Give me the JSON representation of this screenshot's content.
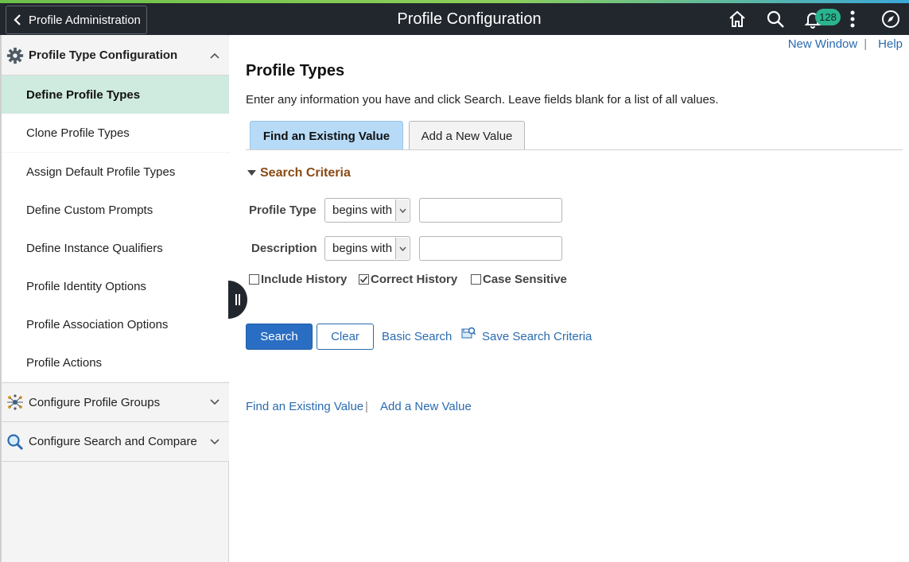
{
  "header": {
    "back_label": "Profile Administration",
    "title": "Profile Configuration",
    "notification_count": "128",
    "icons": [
      "home-icon",
      "search-icon",
      "bell-icon",
      "more-icon",
      "navigator-icon"
    ]
  },
  "sidebar": {
    "group1": {
      "label": "Profile Type Configuration",
      "icon": "gear-icon"
    },
    "items": [
      {
        "label": "Define Profile Types",
        "active": true
      },
      {
        "label": "Clone Profile Types"
      },
      {
        "label": "Assign Default Profile Types"
      },
      {
        "label": "Define Custom Prompts"
      },
      {
        "label": "Define Instance Qualifiers"
      },
      {
        "label": "Profile Identity Options"
      },
      {
        "label": "Profile Association Options"
      },
      {
        "label": "Profile Actions"
      }
    ],
    "group2": {
      "label": "Configure Profile Groups",
      "icon": "network-icon"
    },
    "group3": {
      "label": "Configure Search and Compare",
      "icon": "magnifier-icon"
    }
  },
  "toplinks": {
    "new_window": "New Window",
    "help": "Help",
    "sep": "|"
  },
  "content": {
    "title": "Profile Types",
    "instructions": "Enter any information you have and click Search. Leave fields blank for a list of all values.",
    "tabs": {
      "find": "Find an Existing Value",
      "add": "Add a New Value"
    },
    "criteria_label": "Search Criteria",
    "fields": {
      "profile_type": {
        "label": "Profile Type",
        "operator": "begins with",
        "value": ""
      },
      "description": {
        "label": "Description",
        "operator": "begins with",
        "value": ""
      }
    },
    "checkboxes": [
      {
        "label": "Include History",
        "checked": false
      },
      {
        "label": "Correct History",
        "checked": true
      },
      {
        "label": "Case Sensitive",
        "checked": false
      }
    ],
    "buttons": {
      "search": "Search",
      "clear": "Clear"
    },
    "links": {
      "basic_search": "Basic Search",
      "save_criteria": "Save Search Criteria"
    },
    "bottom_links": {
      "find": "Find an Existing Value",
      "add": "Add a New Value",
      "sep": "|"
    }
  },
  "colors": {
    "header_bg": "#22272e",
    "active_nav_bg": "#cfeadf",
    "active_tab_bg": "#b7dbf7",
    "primary_button": "#2a6ec3",
    "link": "#2a6bb0",
    "criteria_text": "#8a4a14",
    "badge_bg": "#2bb38f"
  }
}
